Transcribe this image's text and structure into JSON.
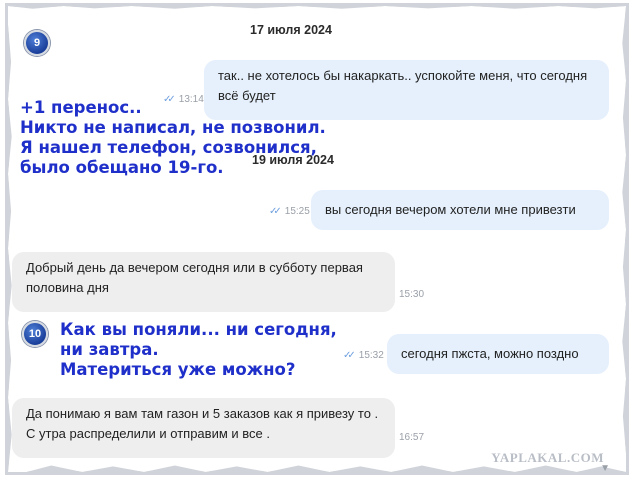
{
  "badges": {
    "first": "9",
    "second": "10"
  },
  "dates": {
    "d1": "17 июля 2024",
    "d2": "19 июля 2024"
  },
  "messages": [
    {
      "dir": "out",
      "text": "так.. не хотелось бы накаркать.. успокойте меня, что сегодня всё будет",
      "time": "13:14"
    },
    {
      "dir": "out",
      "text": "вы сегодня вечером хотели мне привезти",
      "time": "15:25"
    },
    {
      "dir": "in",
      "text": "Добрый день да вечером сегодня или в субботу первая половина дня",
      "time": "15:30"
    },
    {
      "dir": "out",
      "text": "сегодня пжста, можно поздно",
      "time": "15:32"
    },
    {
      "dir": "in",
      "text": "Да понимаю я вам там газон и 5 заказов как я привезу то . С утра распределили и отправим и все .",
      "time": "16:57"
    }
  ],
  "annotations": {
    "first": [
      "+1 перенос..",
      "Никто не написал, не позвонил.",
      "Я нашел телефон, созвонился,",
      "было обещано 19-го."
    ],
    "second": [
      "Как вы поняли... ни сегодня,",
      "ни завтра.",
      "Материться уже можно?"
    ]
  },
  "watermark": "YAPLAKAL.COM",
  "colors": {
    "annotation": "#1f2fc9",
    "outgoing_bubble": "#e5f0fc",
    "incoming_bubble": "#eeeeef",
    "read_tick": "#6fa0e0"
  }
}
